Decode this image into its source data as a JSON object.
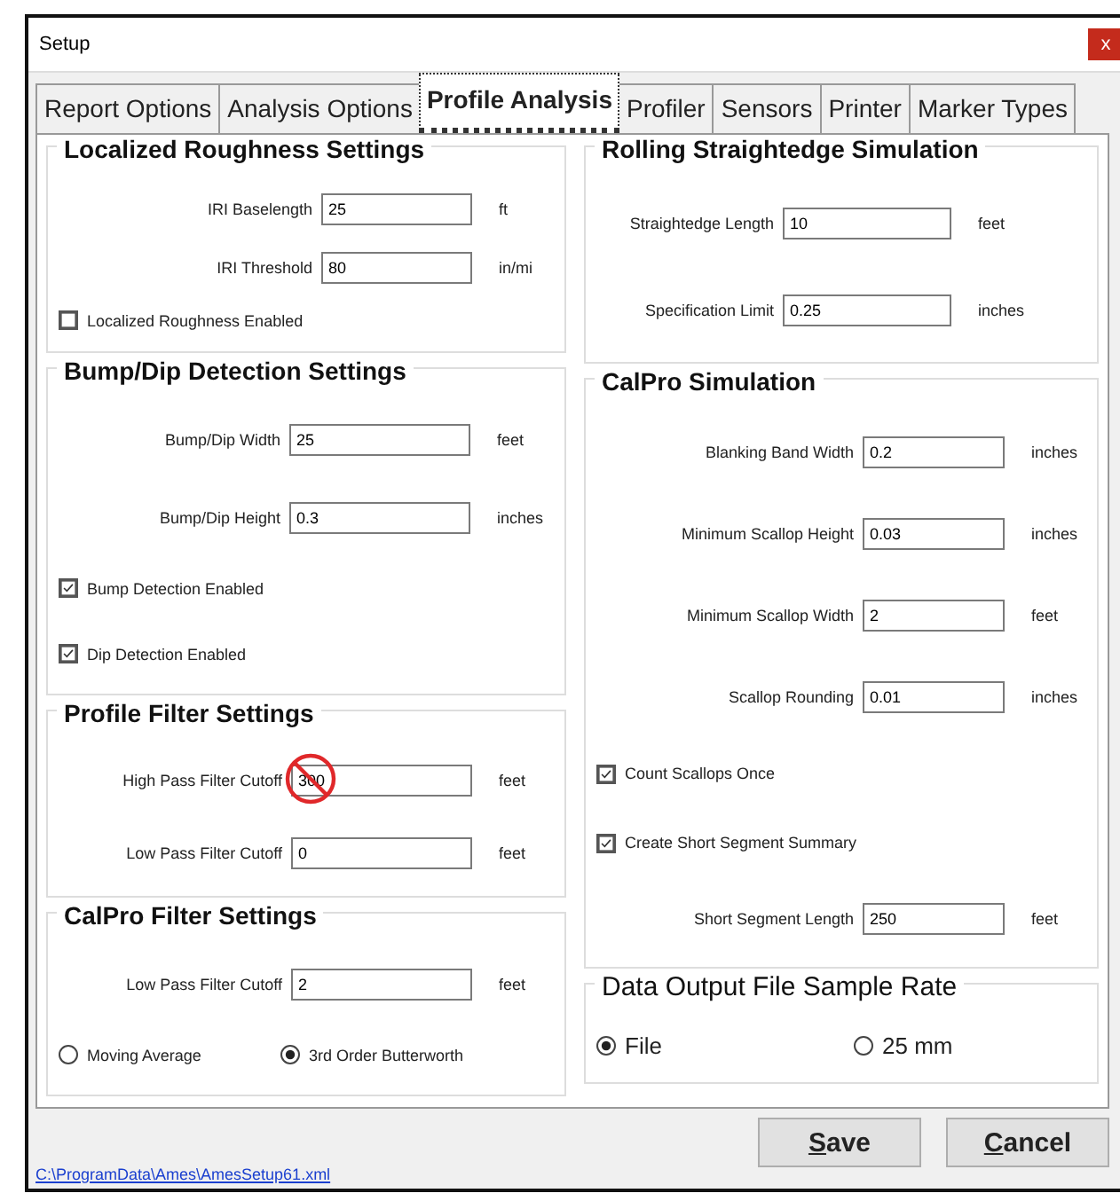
{
  "window": {
    "title": "Setup",
    "close": "x"
  },
  "tabs": [
    {
      "label": "Report Options",
      "selected": false
    },
    {
      "label": "Analysis Options",
      "selected": false
    },
    {
      "label": "Profile Analysis",
      "selected": true
    },
    {
      "label": "Profiler",
      "selected": false
    },
    {
      "label": "Sensors",
      "selected": false
    },
    {
      "label": "Printer",
      "selected": false
    },
    {
      "label": "Marker Types",
      "selected": false
    }
  ],
  "left_groups": [
    {
      "title": "Localized Roughness Settings",
      "items": [
        {
          "kind": "field",
          "label": "IRI Baselength",
          "value": "25",
          "unit": "ft"
        },
        {
          "kind": "field",
          "label": "IRI Threshold",
          "value": "80",
          "unit": "in/mi"
        },
        {
          "kind": "check",
          "label": "Localized Roughness Enabled",
          "checked": false
        }
      ]
    },
    {
      "title": "Bump/Dip Detection Settings",
      "items": [
        {
          "kind": "field",
          "label": "Bump/Dip Width",
          "value": "25",
          "unit": "feet"
        },
        {
          "kind": "field",
          "label": "Bump/Dip Height",
          "value": "0.3",
          "unit": "inches"
        },
        {
          "kind": "check",
          "label": "Bump Detection Enabled",
          "checked": true
        },
        {
          "kind": "check",
          "label": "Dip Detection Enabled",
          "checked": true
        }
      ]
    },
    {
      "title": "Profile Filter Settings",
      "items": [
        {
          "kind": "field",
          "label": "High Pass Filter Cutoff",
          "value": "300",
          "unit": "feet",
          "crossed_out": true
        },
        {
          "kind": "field",
          "label": "Low Pass Filter Cutoff",
          "value": "0",
          "unit": "feet"
        }
      ]
    },
    {
      "title": "CalPro Filter Settings",
      "items": [
        {
          "kind": "field",
          "label": "Low Pass Filter Cutoff",
          "value": "2",
          "unit": "feet"
        },
        {
          "kind": "radios",
          "options": [
            {
              "label": "Moving Average",
              "selected": false
            },
            {
              "label": "3rd Order Butterworth",
              "selected": true
            }
          ]
        }
      ]
    }
  ],
  "right_groups": [
    {
      "title": "Rolling Straightedge Simulation",
      "items": [
        {
          "kind": "field",
          "label": "Straightedge Length",
          "value": "10",
          "unit": "feet"
        },
        {
          "kind": "field",
          "label": "Specification Limit",
          "value": "0.25",
          "unit": "inches"
        }
      ]
    },
    {
      "title": "CalPro Simulation",
      "items": [
        {
          "kind": "field",
          "label": "Blanking Band Width",
          "value": "0.2",
          "unit": "inches"
        },
        {
          "kind": "field",
          "label": "Minimum Scallop Height",
          "value": "0.03",
          "unit": "inches"
        },
        {
          "kind": "field",
          "label": "Minimum Scallop Width",
          "value": "2",
          "unit": "feet"
        },
        {
          "kind": "field",
          "label": "Scallop Rounding",
          "value": "0.01",
          "unit": "inches"
        },
        {
          "kind": "check",
          "label": "Count Scallops Once",
          "checked": true
        },
        {
          "kind": "check",
          "label": "Create Short Segment Summary",
          "checked": true
        },
        {
          "kind": "field",
          "label": "Short Segment Length",
          "value": "250",
          "unit": "feet"
        }
      ]
    },
    {
      "title": "Data Output File Sample Rate",
      "large": true,
      "items": [
        {
          "kind": "radios",
          "options": [
            {
              "label": "File",
              "selected": true
            },
            {
              "label": "25 mm",
              "selected": false
            }
          ]
        }
      ]
    }
  ],
  "file_link": "C:\\ProgramData\\Ames\\AmesSetup61.xml",
  "buttons": [
    {
      "label": "Save",
      "mnemonic_underlined": true
    },
    {
      "label": "Cancel",
      "mnemonic_underlined": true
    }
  ]
}
